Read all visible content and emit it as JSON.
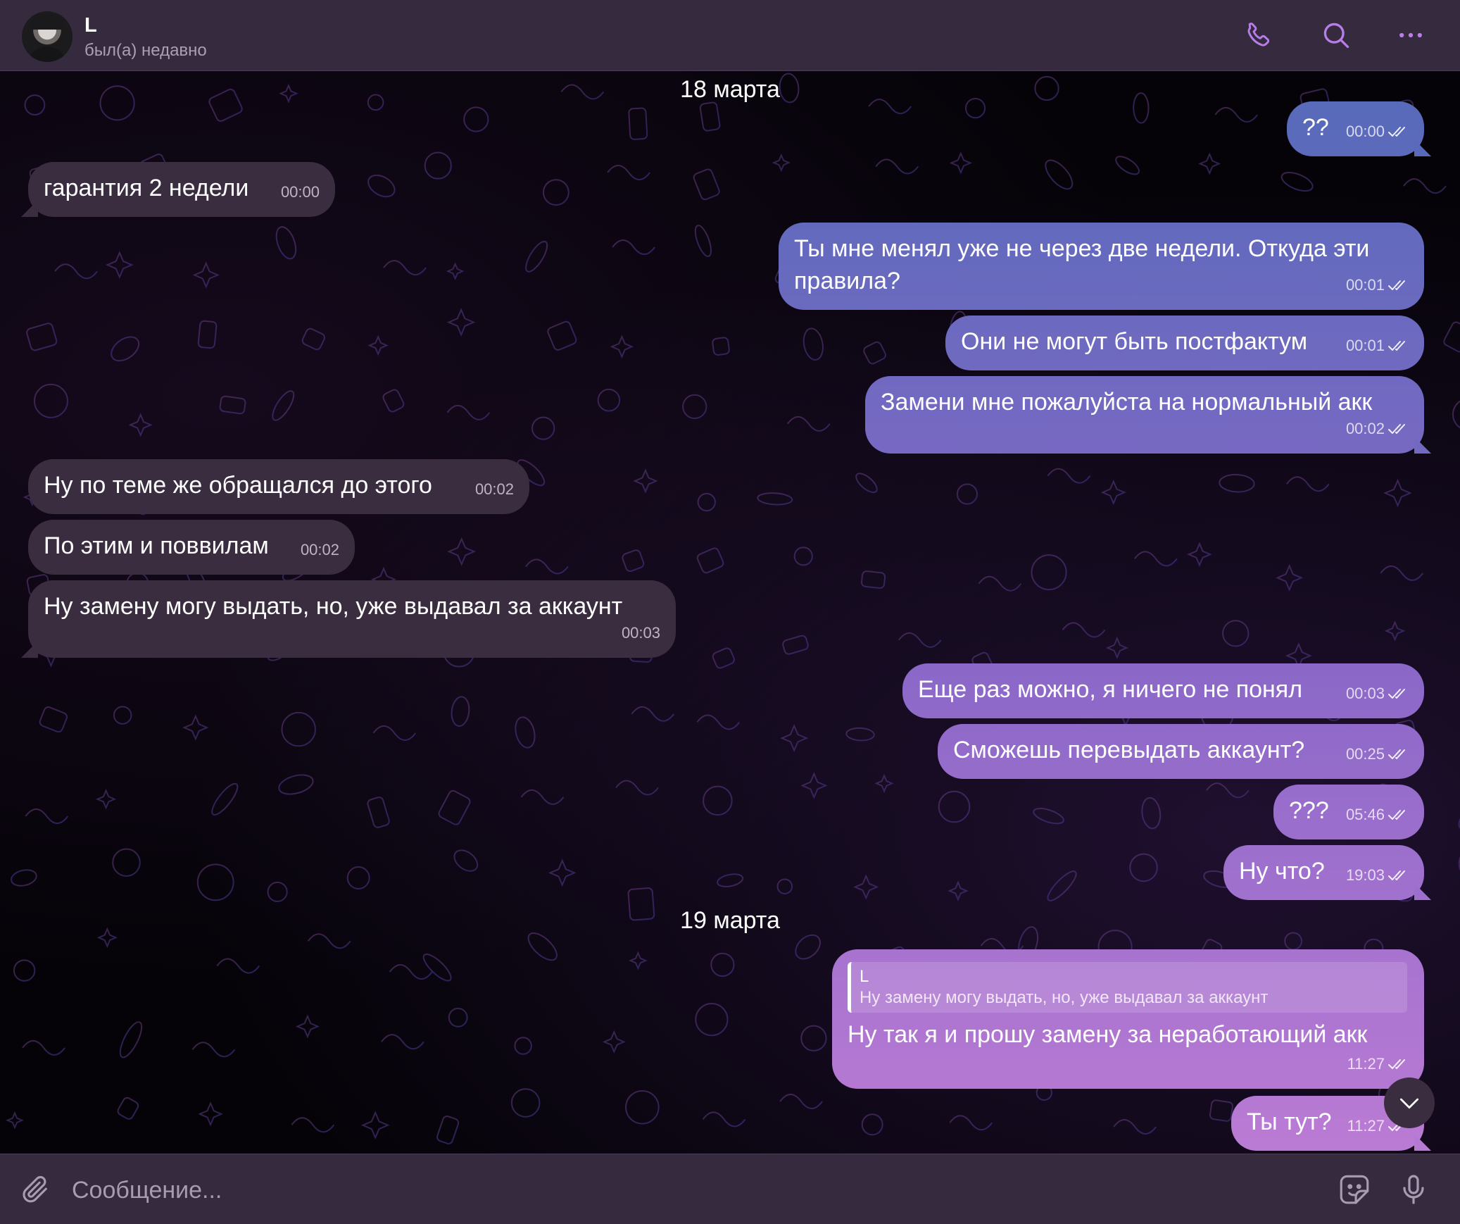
{
  "header": {
    "name": "L",
    "status": "был(а) недавно",
    "icons": [
      "phone-icon",
      "search-icon",
      "more-icon"
    ]
  },
  "dates": [
    "18 марта",
    "19 марта"
  ],
  "messages": [
    {
      "dir": "out",
      "text": "??",
      "time": "00:00",
      "read": true
    },
    {
      "dir": "in",
      "text": "гарантия 2 недели",
      "time": "00:00"
    },
    {
      "dir": "out",
      "text_lines": [
        "Ты мне менял уже не через две недели. Откуда эти",
        "правила?"
      ],
      "time": "00:01",
      "read": true
    },
    {
      "dir": "out",
      "text": "Они не могут быть постфактум",
      "time": "00:01",
      "read": true
    },
    {
      "dir": "out",
      "text": "Замени мне пожалуйста на нормальный акк",
      "time": "00:02",
      "read": true
    },
    {
      "dir": "in",
      "text": "Ну по теме же обращался до этого",
      "time": "00:02"
    },
    {
      "dir": "in",
      "text": "По этим и поввилам",
      "time": "00:02"
    },
    {
      "dir": "in",
      "text": "Ну замену могу выдать, но, уже выдавал за аккаунт",
      "time": "00:03"
    },
    {
      "dir": "out",
      "text": "Еще раз можно, я ничего не понял",
      "time": "00:03",
      "read": true
    },
    {
      "dir": "out",
      "text": "Сможешь перевыдать аккаунт?",
      "time": "00:25",
      "read": true
    },
    {
      "dir": "out",
      "text": "???",
      "time": "05:46",
      "read": true
    },
    {
      "dir": "out",
      "text": "Ну что?",
      "time": "19:03",
      "read": true
    },
    {
      "dir": "out",
      "reply": {
        "name": "L",
        "text": "Ну замену могу выдать, но, уже выдавал за аккаунт"
      },
      "text": "Ну так я и прошу замену за неработающий акк",
      "time": "11:27",
      "read": true
    },
    {
      "dir": "out",
      "text": "Ты тут?",
      "time": "11:27",
      "read": true
    }
  ],
  "colors": {
    "header_bg": "#352a3e",
    "incoming_bubble": "#3a2d40",
    "outgoing_gradient_top": "#4f6bb8",
    "outgoing_gradient_mid": "#8b68c8",
    "outgoing_gradient_bottom": "#c27ed6",
    "icon_accent": "#b77ee8"
  },
  "composer": {
    "placeholder": "Сообщение..."
  }
}
